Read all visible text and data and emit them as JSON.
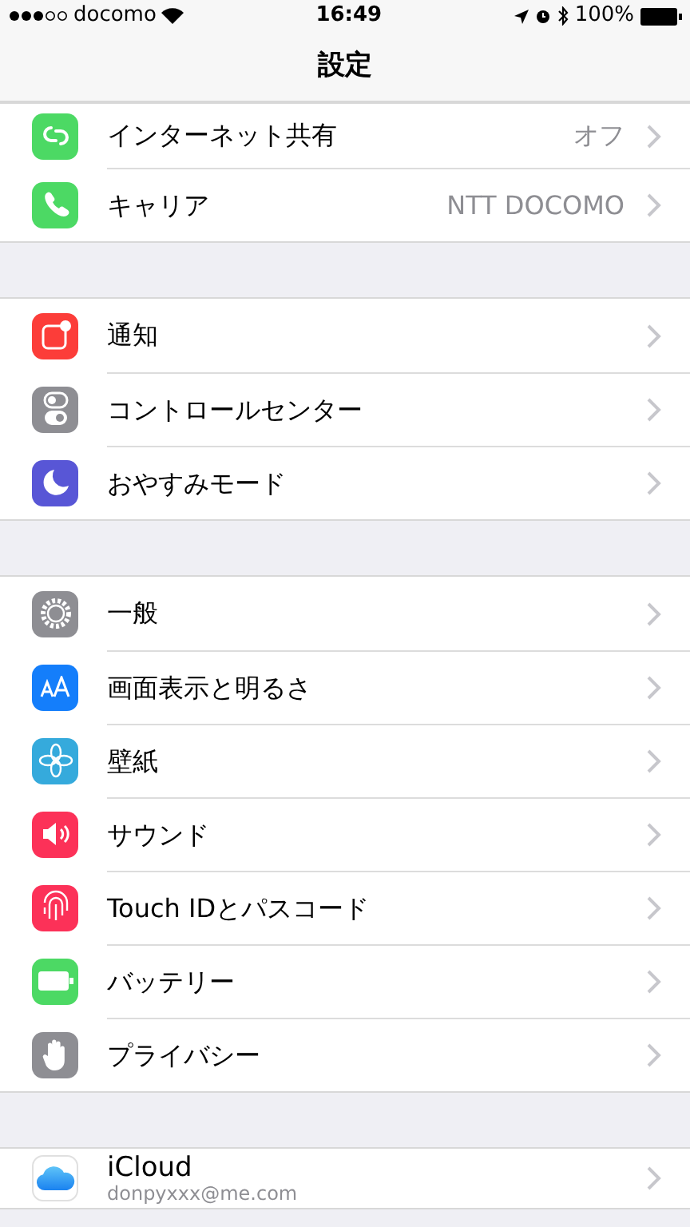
{
  "status_bar": {
    "carrier": "docomo",
    "time": "16:49",
    "battery": "100%"
  },
  "nav": {
    "title": "設定"
  },
  "sections": [
    {
      "rows": [
        {
          "kind": "hotspot",
          "label": "インターネット共有",
          "value": "オフ"
        },
        {
          "kind": "phone",
          "label": "キャリア",
          "value": "NTT DOCOMO"
        }
      ]
    },
    {
      "rows": [
        {
          "kind": "notifications",
          "label": "通知"
        },
        {
          "kind": "control",
          "label": "コントロールセンター"
        },
        {
          "kind": "moon",
          "label": "おやすみモード"
        }
      ]
    },
    {
      "rows": [
        {
          "kind": "gear",
          "label": "一般"
        },
        {
          "kind": "display",
          "label": "画面表示と明るさ"
        },
        {
          "kind": "flower",
          "label": "壁紙"
        },
        {
          "kind": "speaker",
          "label": "サウンド"
        },
        {
          "kind": "fingerprint",
          "label": "Touch IDとパスコード"
        },
        {
          "kind": "battery",
          "label": "バッテリー"
        },
        {
          "kind": "hand",
          "label": "プライバシー"
        }
      ]
    },
    {
      "rows": [
        {
          "kind": "cloud",
          "label": "iCloud",
          "subtitle": "donpyxxx@me.com"
        }
      ]
    }
  ]
}
